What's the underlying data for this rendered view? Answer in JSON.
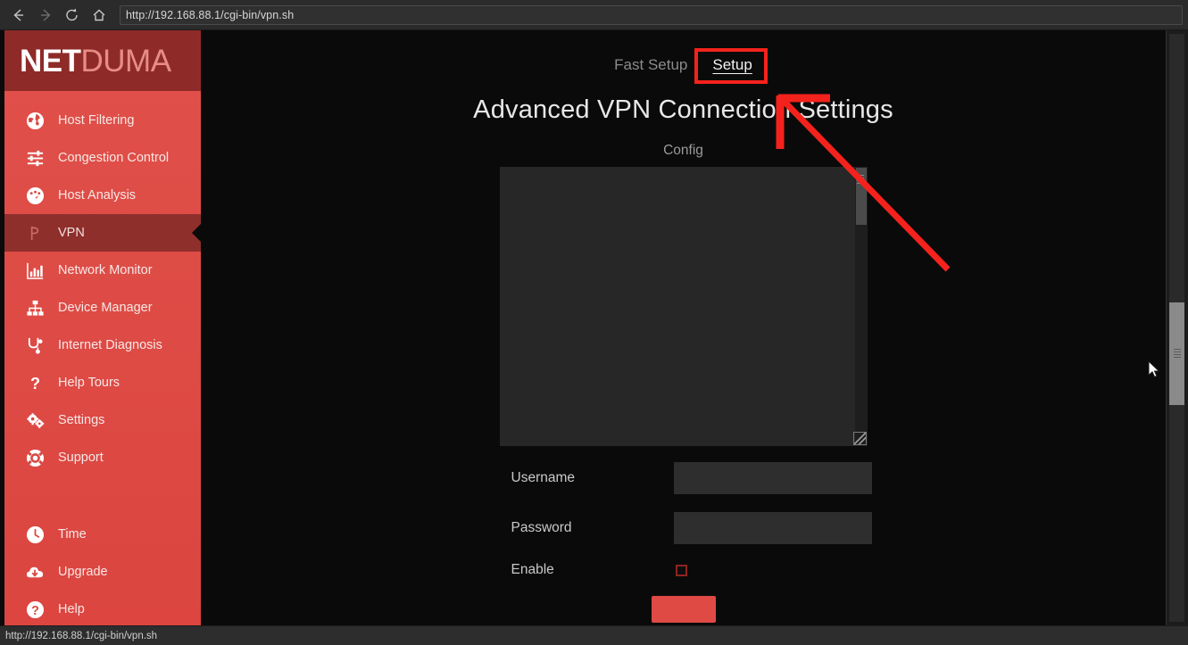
{
  "browser": {
    "url": "http://192.168.88.1/cgi-bin/vpn.sh",
    "status_url": "http://192.168.88.1/cgi-bin/vpn.sh",
    "nav": {
      "back": "back-arrow",
      "forward": "forward-arrow",
      "reload": "reload",
      "home": "home"
    }
  },
  "sidebar": {
    "logo_primary": "NET",
    "logo_secondary": "DUMA",
    "items": [
      {
        "label": "Host Filtering",
        "icon": "globe-icon",
        "active": false
      },
      {
        "label": "Congestion Control",
        "icon": "sliders-icon",
        "active": false
      },
      {
        "label": "Host Analysis",
        "icon": "gauge-icon",
        "active": false
      },
      {
        "label": "VPN",
        "icon": "vpn-icon",
        "active": true
      },
      {
        "label": "Network Monitor",
        "icon": "bar-chart-icon",
        "active": false
      },
      {
        "label": "Device Manager",
        "icon": "sitemap-icon",
        "active": false
      },
      {
        "label": "Internet Diagnosis",
        "icon": "stethoscope-icon",
        "active": false
      },
      {
        "label": "Help Tours",
        "icon": "question-icon",
        "active": false
      },
      {
        "label": "Settings",
        "icon": "gears-icon",
        "active": false
      },
      {
        "label": "Support",
        "icon": "lifebuoy-icon",
        "active": false
      }
    ],
    "bottom_items": [
      {
        "label": "Time",
        "icon": "clock-icon"
      },
      {
        "label": "Upgrade",
        "icon": "cloud-download-icon"
      },
      {
        "label": "Help",
        "icon": "question-circle-icon"
      }
    ]
  },
  "main": {
    "tabs": [
      {
        "label": "Fast Setup",
        "active": false
      },
      {
        "label": "Setup",
        "active": true
      }
    ],
    "title": "Advanced VPN Connection Settings",
    "config_label": "Config",
    "config_value": "",
    "fields": [
      {
        "label": "Username",
        "value": "",
        "type": "text"
      },
      {
        "label": "Password",
        "value": "",
        "type": "password"
      },
      {
        "label": "Enable",
        "value": "",
        "type": "checkbox",
        "checked": false
      }
    ],
    "submit_label": ""
  },
  "annotations": {
    "highlight_target": "Setup",
    "color": "#f4221d"
  }
}
